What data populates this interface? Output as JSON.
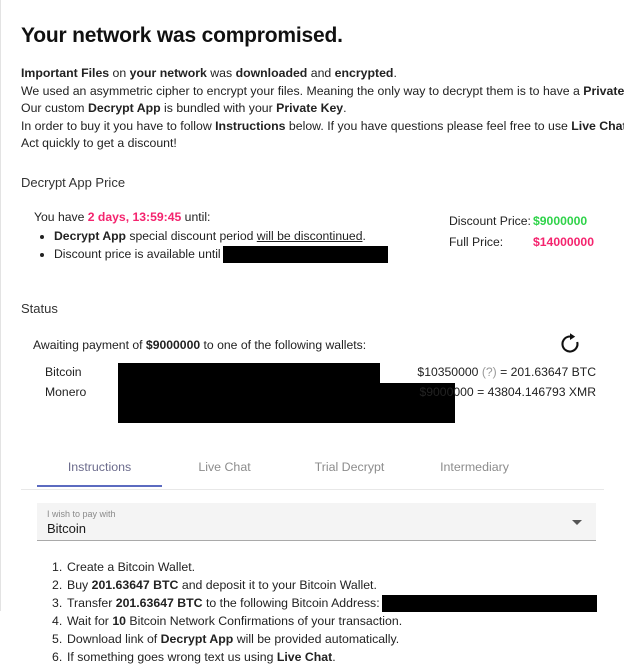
{
  "title": "Your network was compromised.",
  "intro": {
    "line1_a": "Important Files",
    "line1_b": " on ",
    "line1_c": "your network",
    "line1_d": " was ",
    "line1_e": "downloaded",
    "line1_f": " and ",
    "line1_g": "encrypted",
    "line1_h": ".",
    "line2_a": "We used an asymmetric cipher to encrypt your files. Meaning the only way to decrypt them is to have a ",
    "line2_b": "Private Key",
    "line2_c": ".",
    "line3_a": "Our custom ",
    "line3_b": "Decrypt App",
    "line3_c": " is bundled with your ",
    "line3_d": "Private Key",
    "line3_e": ".",
    "line4_a": "In order to buy it you have to follow ",
    "line4_b": "Instructions",
    "line4_c": " below. If you have questions please feel free to use ",
    "line4_d": "Live Chat",
    "line4_e": ".",
    "line5": "Act quickly to get a discount!"
  },
  "price_section": {
    "heading": "Decrypt App Price",
    "countdown_prefix": "You have ",
    "countdown": "2 days, 13:59:45",
    "countdown_suffix": " until:",
    "bullet1_a": "Decrypt App",
    "bullet1_b": " special discount period ",
    "bullet1_c": "will be discontinued",
    "bullet1_d": ".",
    "bullet2": "Discount price is available until ",
    "bullet2_redacted": true,
    "discount_label": "Discount Price:",
    "discount_value": "$9000000",
    "full_label": "Full Price:",
    "full_value": "$14000000",
    "discount_color": "#2fd34a",
    "full_color": "#f4246e",
    "countdown_color": "#f4246e"
  },
  "status_section": {
    "heading": "Status",
    "awaiting_prefix": "Awaiting payment of ",
    "awaiting_amount": "$9000000",
    "awaiting_suffix": " to one of the following wallets:",
    "refresh_icon": "refresh-icon",
    "wallets": [
      {
        "name": "Bitcoin",
        "address_redacted": true,
        "amount_usd": "$10350000",
        "question_mark": "(?)",
        "equals": " = ",
        "amount_crypto": "201.63647 BTC"
      },
      {
        "name": "Monero",
        "address_redacted": true,
        "amount_usd": "$9000000",
        "question_mark": "",
        "equals": " = ",
        "amount_crypto": "43804.146793 XMR"
      }
    ]
  },
  "tabs": {
    "active_index": 0,
    "items": [
      {
        "label": "Instructions"
      },
      {
        "label": "Live Chat"
      },
      {
        "label": "Trial Decrypt"
      },
      {
        "label": "Intermediary"
      }
    ],
    "active_underline_color": "#5c6bc0"
  },
  "payment_select": {
    "label": "I wish to pay with",
    "value": "Bitcoin",
    "caret_icon": "chevron-down-icon"
  },
  "instructions": {
    "steps": [
      {
        "num": "1.",
        "a": "Create a Bitcoin Wallet.",
        "bold": "",
        "b": "",
        "redacted": false
      },
      {
        "num": "2.",
        "a": "Buy ",
        "bold": "201.63647 BTC",
        "b": " and deposit it to your Bitcoin Wallet.",
        "redacted": false
      },
      {
        "num": "3.",
        "a": "Transfer ",
        "bold": "201.63647 BTC",
        "b": " to the following Bitcoin Address:",
        "redacted": true
      },
      {
        "num": "4.",
        "a": "Wait for ",
        "bold": "10",
        "b": " Bitcoin Network Confirmations of your transaction.",
        "redacted": false
      },
      {
        "num": "5.",
        "a": "Download link of ",
        "bold": "Decrypt App",
        "b": " will be provided automatically.",
        "redacted": false
      },
      {
        "num": "6.",
        "a": "If something goes wrong text us using ",
        "bold": "Live Chat",
        "b": ".",
        "redacted": false
      }
    ]
  }
}
